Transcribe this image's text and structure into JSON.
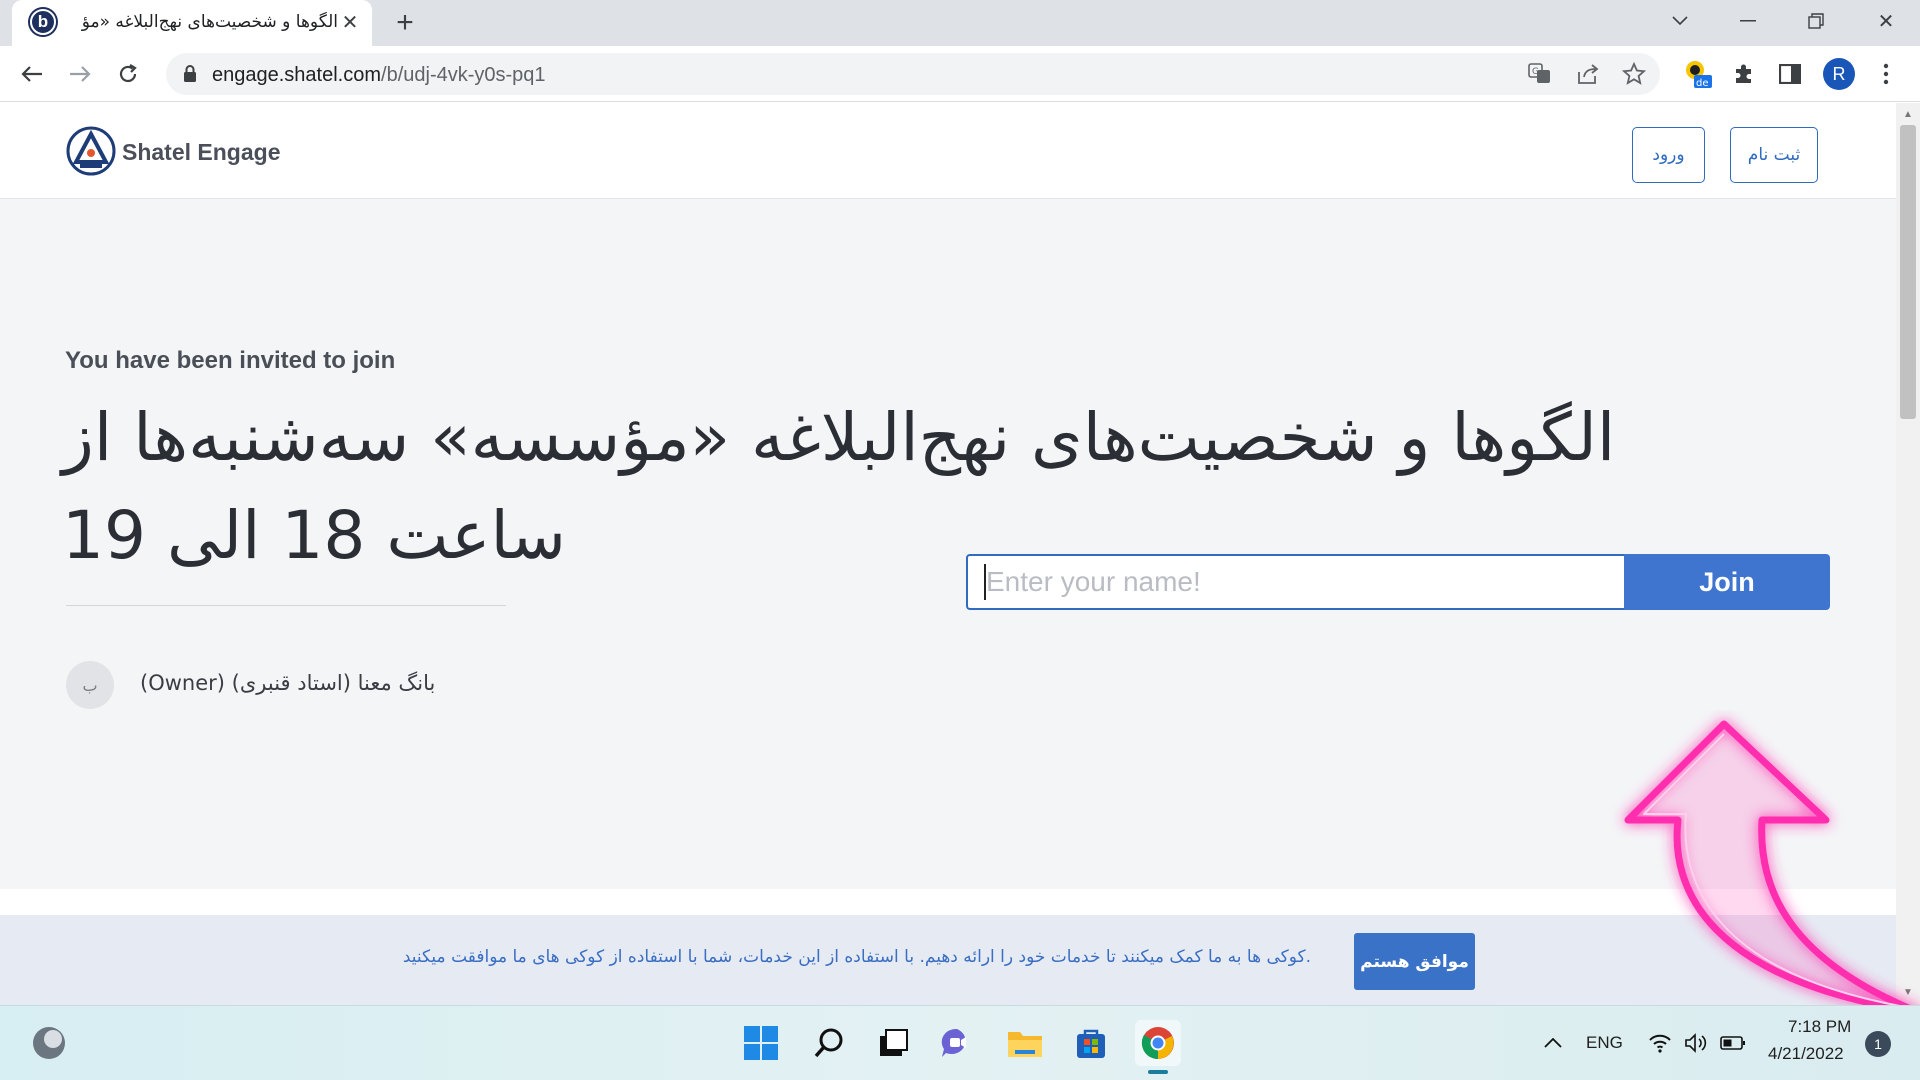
{
  "browser": {
    "tab_title": "الگوها و شخصیت‌های نهج‌البلاغه «مؤ",
    "tab_favicon_letter": "b",
    "url_host": "engage.shatel.com",
    "url_path": "/b/udj-4vk-y0s-pq1",
    "profile_initial": "R"
  },
  "header": {
    "brand": "Shatel Engage",
    "login_label": "ورود",
    "signup_label": "ثبت نام"
  },
  "main": {
    "invite_label": "You have been invited to join",
    "event_title": "الگوها و شخصیت‌های نهج‌البلاغه «مؤسسه» سه‌شنبه‌ها از ساعت 18 الی 19",
    "owner_avatar_letter": "ب",
    "owner_name": "بانگ معنا (استاد قنبری) (Owner)",
    "name_placeholder": "Enter your name!",
    "join_label": "Join"
  },
  "cookie": {
    "text": ".کوکی ها به ما کمک میکنند تا خدمات خود را ارائه دهیم. با استفاده از این خدمات، شما با استفاده از کوکی های ما موافقت میکنید",
    "accept_label": "موافق هستم"
  },
  "taskbar": {
    "lang": "ENG",
    "time": "7:18 PM",
    "date": "4/21/2022",
    "notification_count": "1"
  },
  "colors": {
    "accent": "#3f74cf",
    "annotation": "#ff2fae"
  }
}
